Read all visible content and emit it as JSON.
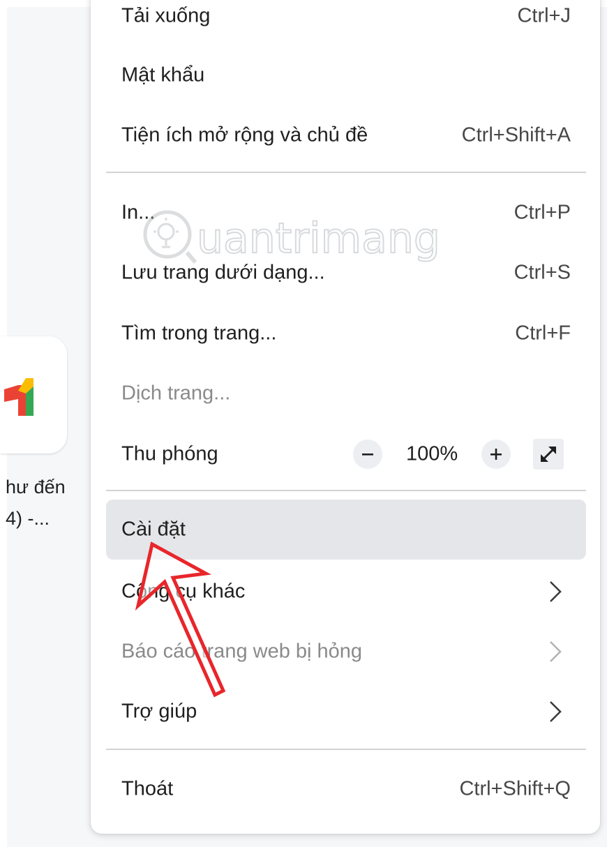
{
  "background_tile": {
    "icon": "gmail-icon",
    "caption_line1": "hư đến",
    "caption_line2": "4) -..."
  },
  "menu": {
    "downloads": {
      "label": "Tải xuống",
      "shortcut": "Ctrl+J"
    },
    "passwords": {
      "label": "Mật khẩu"
    },
    "extensions": {
      "label": "Tiện ích mở rộng và chủ đề",
      "shortcut": "Ctrl+Shift+A"
    },
    "print": {
      "label": "In...",
      "shortcut": "Ctrl+P"
    },
    "save_page": {
      "label": "Lưu trang dưới dạng...",
      "shortcut": "Ctrl+S"
    },
    "find": {
      "label": "Tìm trong trang...",
      "shortcut": "Ctrl+F"
    },
    "translate": {
      "label": "Dịch trang...",
      "disabled": true
    },
    "zoom": {
      "label": "Thu phóng",
      "value": "100%",
      "decrease_icon": "minus-icon",
      "increase_icon": "plus-icon",
      "fullscreen_icon": "fullscreen-icon"
    },
    "settings": {
      "label": "Cài đặt",
      "highlighted": true
    },
    "more_tools": {
      "label": "Công cụ khác",
      "icon": "chevron-right-icon"
    },
    "report_broken": {
      "label": "Báo cáo trang web bị hỏng",
      "disabled": true,
      "icon": "chevron-right-icon"
    },
    "help": {
      "label": "Trợ giúp",
      "icon": "chevron-right-icon"
    },
    "exit": {
      "label": "Thoát",
      "shortcut": "Ctrl+Shift+Q"
    }
  },
  "annotation": {
    "icon": "red-arrow-icon",
    "color": "#e8262b"
  },
  "watermark": {
    "icon": "lightbulb-icon",
    "text": "uantrimang"
  }
}
